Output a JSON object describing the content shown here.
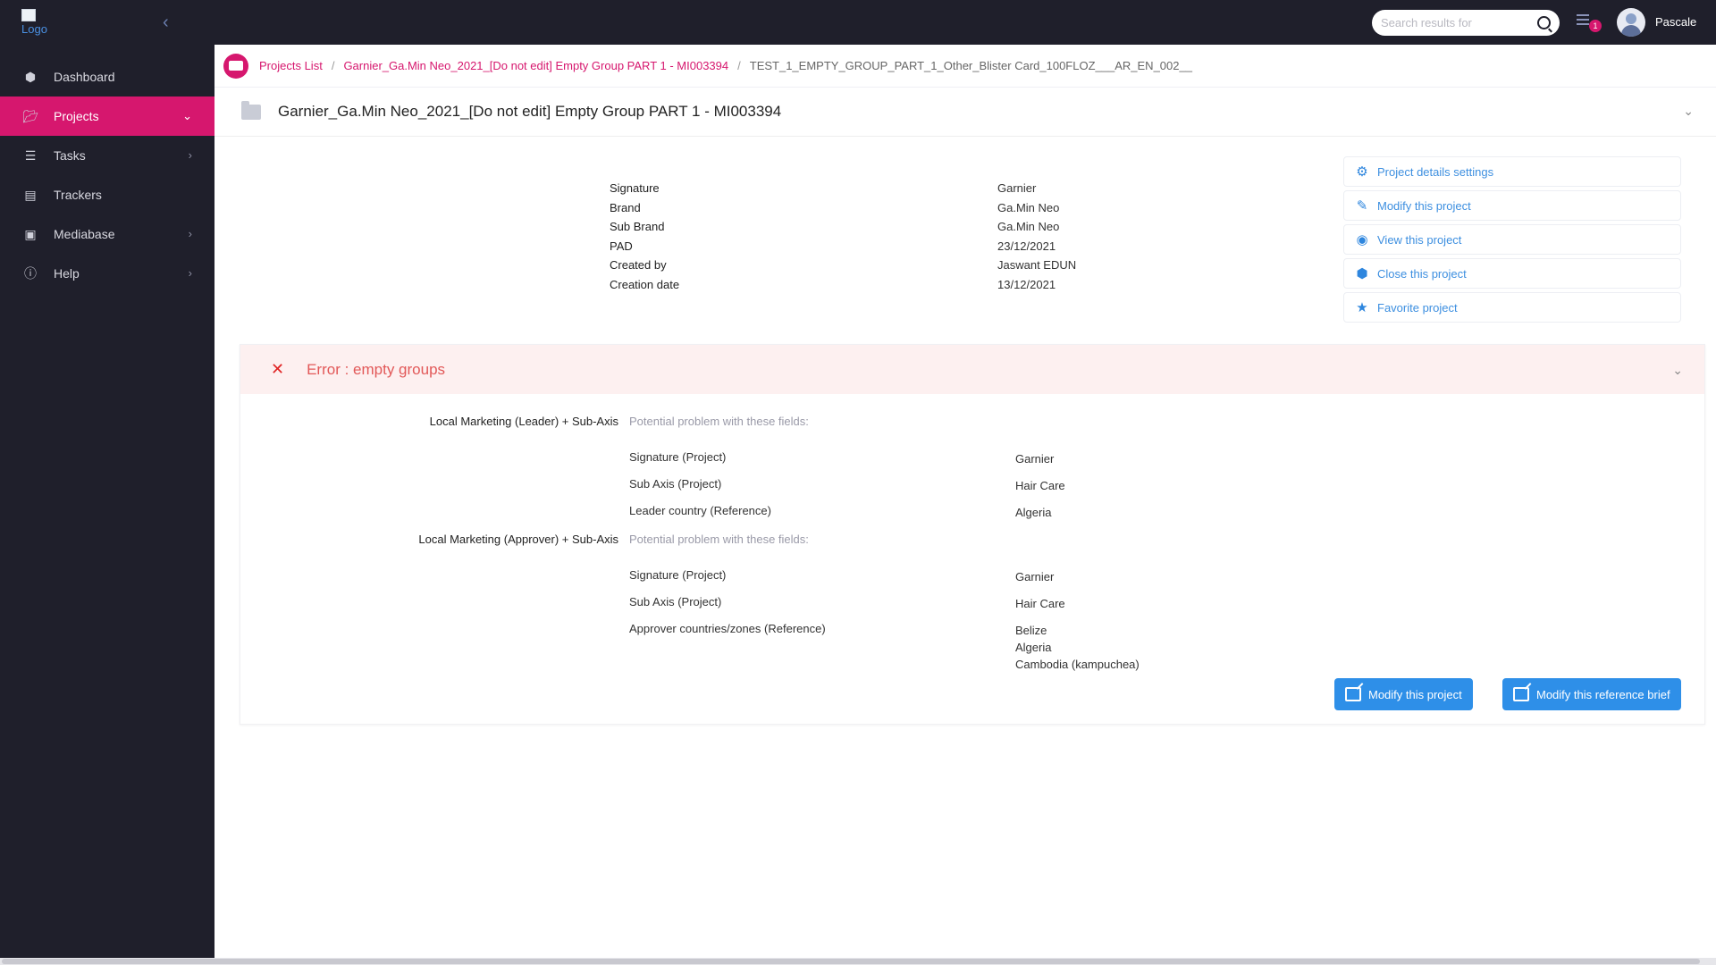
{
  "topbar": {
    "logo_alt": "Logo",
    "search_placeholder": "Search results for",
    "notification_count": "1",
    "user_name": "Pascale"
  },
  "sidebar": {
    "items": [
      {
        "label": "Dashboard",
        "icon": "cube-icon",
        "active": false,
        "has_chevron": false
      },
      {
        "label": "Projects",
        "icon": "folder-open-icon",
        "active": true,
        "has_chevron": true
      },
      {
        "label": "Tasks",
        "icon": "list-icon",
        "active": false,
        "has_chevron": true
      },
      {
        "label": "Trackers",
        "icon": "clipboard-icon",
        "active": false,
        "has_chevron": false
      },
      {
        "label": "Mediabase",
        "icon": "image-icon",
        "active": false,
        "has_chevron": true
      },
      {
        "label": "Help",
        "icon": "info-icon",
        "active": false,
        "has_chevron": true
      }
    ]
  },
  "breadcrumb": {
    "items": [
      "Projects List",
      "Garnier_Ga.Min Neo_2021_[Do not edit] Empty Group PART 1 - MI003394",
      "TEST_1_EMPTY_GROUP_PART_1_Other_Blister Card_100FLOZ___AR_EN_002__"
    ]
  },
  "project": {
    "title": "Garnier_Ga.Min Neo_2021_[Do not edit] Empty Group PART 1 - MI003394",
    "details": [
      {
        "label": "Signature",
        "value": "Garnier"
      },
      {
        "label": "Brand",
        "value": "Ga.Min Neo"
      },
      {
        "label": "Sub Brand",
        "value": "Ga.Min Neo"
      },
      {
        "label": "PAD",
        "value": "23/12/2021"
      },
      {
        "label": "Created by",
        "value": "Jaswant EDUN"
      },
      {
        "label": "Creation date",
        "value": "13/12/2021"
      }
    ]
  },
  "actions": {
    "items": [
      {
        "label": "Project details settings",
        "icon": "gear-icon"
      },
      {
        "label": "Modify this project",
        "icon": "edit-icon"
      },
      {
        "label": "View this project",
        "icon": "eye-icon"
      },
      {
        "label": "Close this project",
        "icon": "box-icon"
      },
      {
        "label": "Favorite project",
        "icon": "star-icon"
      }
    ]
  },
  "error": {
    "title": "Error : empty groups",
    "groups": [
      {
        "label": "Local Marketing (Leader) + Sub-Axis",
        "hint": "Potential problem with these fields:",
        "fields": [
          {
            "name": "Signature (Project)",
            "values": [
              "Garnier"
            ]
          },
          {
            "name": "Sub Axis (Project)",
            "values": [
              "Hair Care"
            ]
          },
          {
            "name": "Leader country (Reference)",
            "values": [
              "Algeria"
            ]
          }
        ]
      },
      {
        "label": "Local Marketing (Approver) + Sub-Axis",
        "hint": "Potential problem with these fields:",
        "fields": [
          {
            "name": "Signature (Project)",
            "values": [
              "Garnier"
            ]
          },
          {
            "name": "Sub Axis (Project)",
            "values": [
              "Hair Care"
            ]
          },
          {
            "name": "Approver countries/zones (Reference)",
            "values": [
              "Belize",
              "Algeria",
              "Cambodia (kampuchea)"
            ]
          }
        ]
      }
    ],
    "buttons": {
      "modify_project": "Modify this project",
      "modify_brief": "Modify this reference brief"
    }
  },
  "colors": {
    "brand": "#d6176e",
    "sidebar_bg": "#1f1f2b",
    "link_blue": "#3d8fe0",
    "button_blue": "#2e8fe8",
    "error_red": "#e25858",
    "error_bg": "#fdf0f0"
  }
}
